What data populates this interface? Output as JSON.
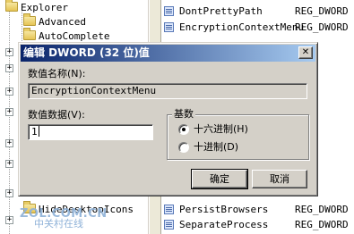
{
  "tree": {
    "items": [
      {
        "label": "Explorer"
      },
      {
        "label": "Advanced"
      },
      {
        "label": "AutoComplete"
      },
      {
        "label": "HideDesktopIcons"
      },
      {
        "label": "中关村在线"
      }
    ]
  },
  "values_list": {
    "rows": [
      {
        "name": "DontPrettyPath",
        "type": "REG_DWORD"
      },
      {
        "name": "EncryptionContextMenu",
        "type": "REG_DWORD"
      },
      {
        "name": "PersistBrowsers",
        "type": "REG_DWORD"
      },
      {
        "name": "SeparateProcess",
        "type": "REG_DWORD"
      }
    ]
  },
  "dialog": {
    "title": "编辑 DWORD (32 位)值",
    "close_glyph": "✕",
    "value_name_label": "数值名称(N):",
    "value_name": "EncryptionContextMenu",
    "value_data_label": "数值数据(V):",
    "value_data": "1",
    "base_label": "基数",
    "base_options": [
      {
        "label": "十六进制(H)",
        "checked": true
      },
      {
        "label": "十进制(D)",
        "checked": false
      }
    ],
    "ok_label": "确定",
    "cancel_label": "取消"
  },
  "watermark": {
    "brand": "ZOL.COM.CN",
    "sub": "中关村在线"
  }
}
